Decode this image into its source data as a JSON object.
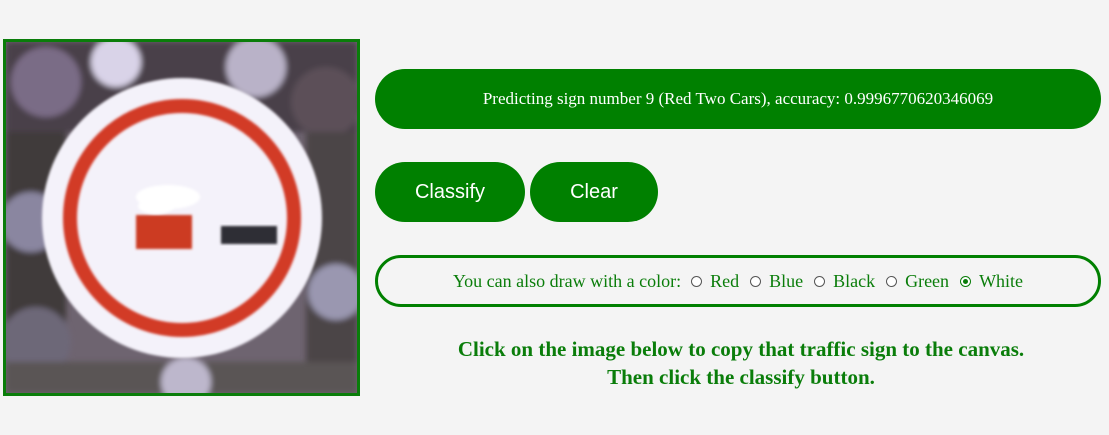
{
  "prediction": {
    "text": "Predicting sign number 9 (Red Two Cars), accuracy: 0.9996770620346069"
  },
  "buttons": {
    "classify_label": "Classify",
    "clear_label": "Clear"
  },
  "color_picker": {
    "prompt": "You can also draw with a color:",
    "options": [
      {
        "label": "Red",
        "checked": false
      },
      {
        "label": "Blue",
        "checked": false
      },
      {
        "label": "Black",
        "checked": false
      },
      {
        "label": "Green",
        "checked": false
      },
      {
        "label": "White",
        "checked": true
      }
    ],
    "selected": "White"
  },
  "instructions": {
    "line1": "Click on the image below to copy that traffic sign to the canvas.",
    "line2": "Then click the classify button."
  },
  "colors": {
    "accent": "#008000",
    "accent_text": "#0a7d0a",
    "background": "#f4f4f4",
    "sign_red": "#d23a28"
  }
}
